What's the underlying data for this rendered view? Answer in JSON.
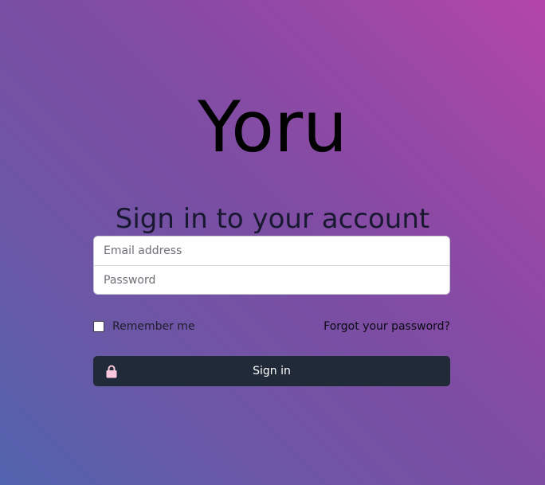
{
  "brand": {
    "name": "Yoru"
  },
  "heading": {
    "text": "Sign in to your account"
  },
  "form": {
    "email": {
      "placeholder": "Email address",
      "value": ""
    },
    "password": {
      "placeholder": "Password",
      "value": ""
    },
    "remember": {
      "label": "Remember me",
      "checked": false
    },
    "forgot_link": "Forgot your password?",
    "submit": {
      "label": "Sign in",
      "icon": "lock-icon"
    }
  },
  "colors": {
    "button_bg": "#212a38",
    "lock_icon": "#f9c8dd",
    "gradient_start": "#5163ad",
    "gradient_end": "#b346a8"
  }
}
